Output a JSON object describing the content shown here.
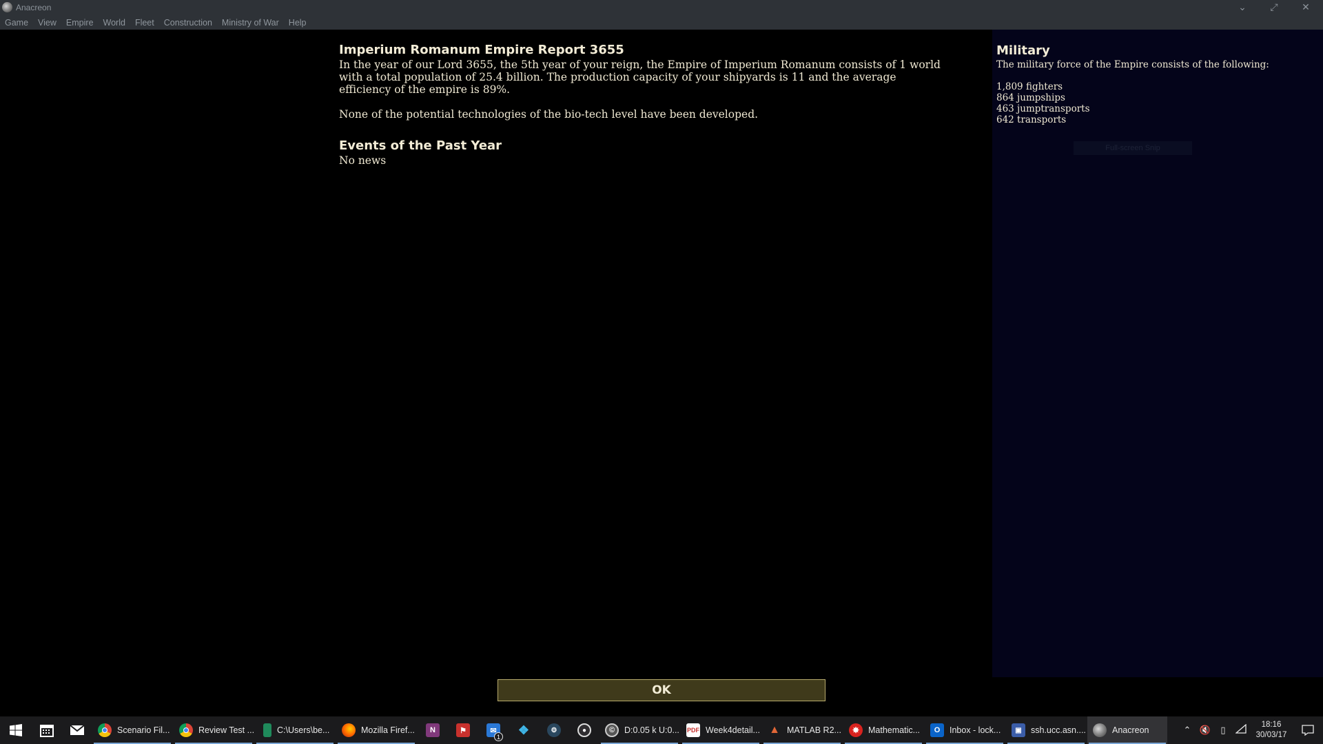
{
  "window": {
    "title": "Anacreon"
  },
  "menu": [
    "Game",
    "View",
    "Empire",
    "World",
    "Fleet",
    "Construction",
    "Ministry of War",
    "Help"
  ],
  "report": {
    "title": "Imperium Romanum Empire Report 3655",
    "paragraph1": "In the year of our Lord 3655, the 5th year of your reign, the Empire of Imperium Romanum consists of 1 world with a total population of 25.4 billion. The production capacity of your shipyards is 11 and the average efficiency of the empire is 89%.",
    "paragraph2": "None of the potential technologies of the bio-tech level have been developed.",
    "events_title": "Events of the Past Year",
    "events_text": "No news"
  },
  "military": {
    "title": "Military",
    "description": "The military force of the Empire consists of the following:",
    "items": [
      "1,809 fighters",
      "864 jumpships",
      "463 jumptransports",
      "642 transports"
    ],
    "ghost_button": "Full-screen Snip"
  },
  "ok_button": "OK",
  "taskbar": {
    "apps": [
      {
        "label": "Scenario Fil...",
        "icon": "chrome-icon"
      },
      {
        "label": "Review Test ...",
        "icon": "chrome-icon"
      },
      {
        "label": "C:\\Users\\be...",
        "icon": "file-explorer-icon"
      },
      {
        "label": "Mozilla Firef...",
        "icon": "firefox-icon"
      },
      {
        "label": "D:0.05 k U:0....",
        "icon": "torrent-icon"
      },
      {
        "label": "Week4detail...",
        "icon": "pdf-icon"
      },
      {
        "label": "MATLAB R2...",
        "icon": "matlab-icon"
      },
      {
        "label": "Mathematic...",
        "icon": "mathematica-icon"
      },
      {
        "label": "Inbox - lock...",
        "icon": "outlook-icon"
      },
      {
        "label": "ssh.ucc.asn....",
        "icon": "ssh-icon"
      },
      {
        "label": "Anacreon",
        "icon": "anacreon-icon"
      }
    ],
    "messenger_badge": "1",
    "clock_time": "18:16",
    "clock_date": "30/03/17"
  }
}
